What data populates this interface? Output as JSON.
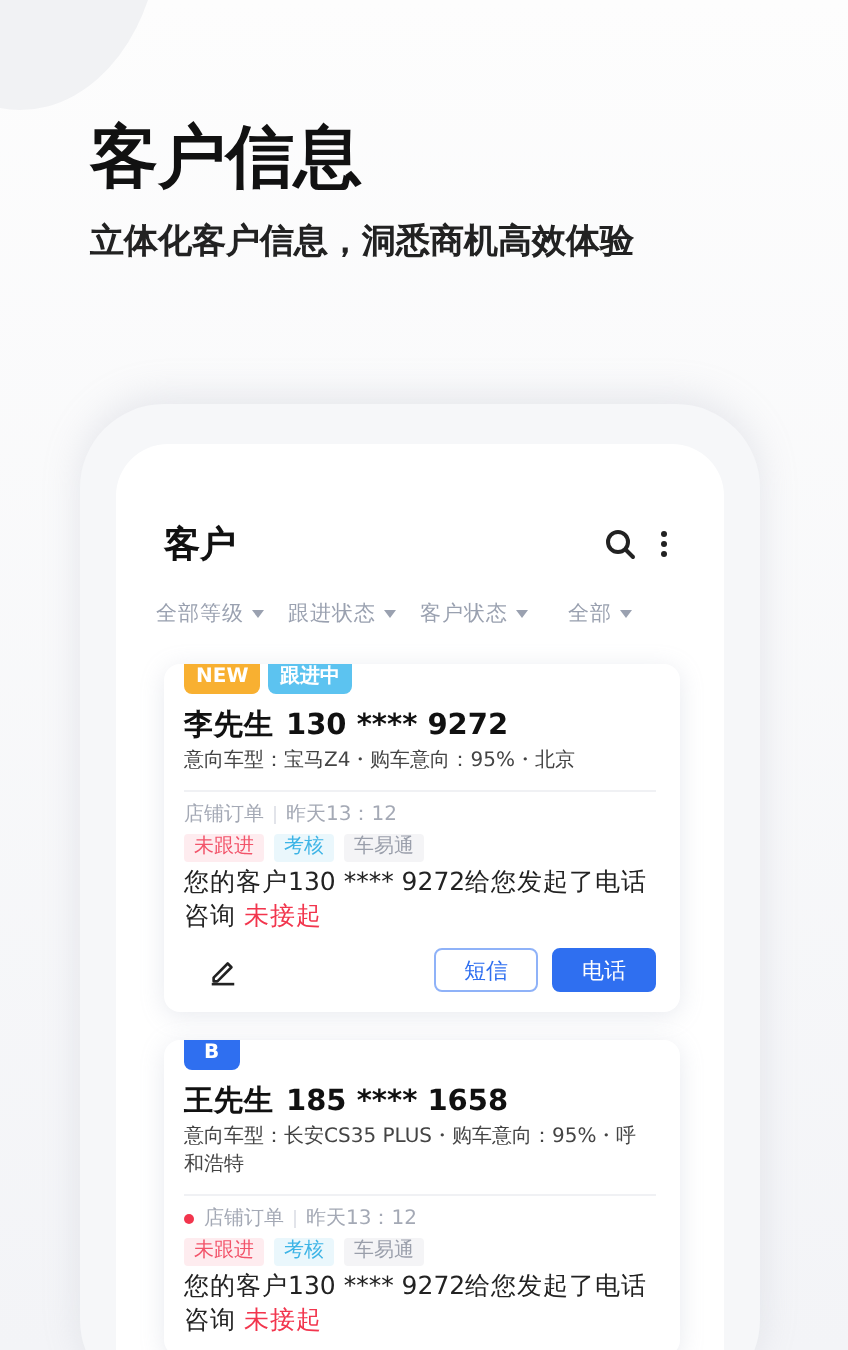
{
  "hero": {
    "title": "客户信息",
    "subtitle": "立体化客户信息，洞悉商机高效体验"
  },
  "app": {
    "title": "客户",
    "filters": [
      {
        "label": "全部等级"
      },
      {
        "label": "跟进状态"
      },
      {
        "label": "客户状态"
      },
      {
        "label": "全部"
      }
    ]
  },
  "customers": [
    {
      "badges": [
        {
          "text": "NEW",
          "kind": "new"
        },
        {
          "text": "跟进中",
          "kind": "status"
        }
      ],
      "name": "李先生",
      "phone": "130 **** 9272",
      "info": "意向车型：宝马Z4・购车意向：95%・北京",
      "unread": false,
      "source": "店铺订单",
      "time": "昨天13：12",
      "tags": [
        {
          "text": "未跟进",
          "color": "#f2546a"
        },
        {
          "text": "考核",
          "color": "#3db4e6"
        },
        {
          "text": "车易通",
          "color": "#9a9fab"
        }
      ],
      "message": "您的客户130 **** 9272给您发起了电话咨询",
      "status": "未接起",
      "actions": [
        {
          "label": "短信",
          "kind": "outline"
        },
        {
          "label": "电话",
          "kind": "primary"
        }
      ]
    },
    {
      "badges": [
        {
          "text": "B",
          "kind": "level"
        }
      ],
      "name": "王先生",
      "phone": "185 **** 1658",
      "info": "意向车型：长安CS35 PLUS・购车意向：95%・呼和浩特",
      "unread": true,
      "source": "店铺订单",
      "time": "昨天13：12",
      "tags": [
        {
          "text": "未跟进",
          "color": "#f2546a"
        },
        {
          "text": "考核",
          "color": "#3db4e6"
        },
        {
          "text": "车易通",
          "color": "#9a9fab"
        }
      ],
      "message": "您的客户130 **** 9272给您发起了电话咨询",
      "status": "未接起"
    }
  ]
}
